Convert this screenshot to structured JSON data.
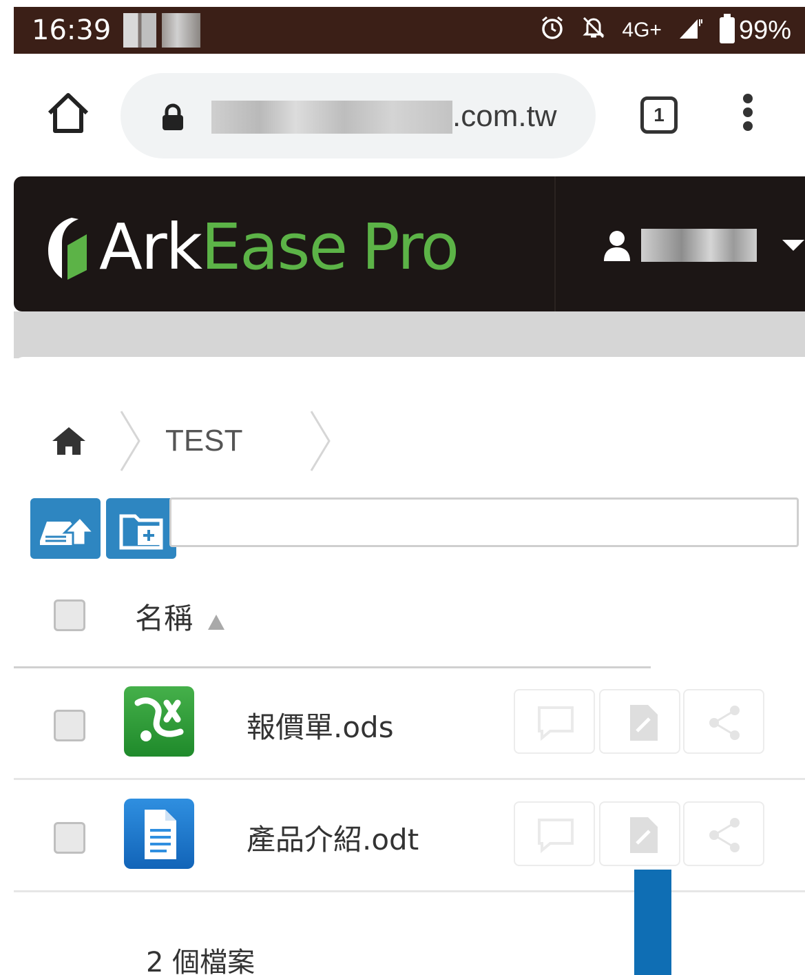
{
  "status_bar": {
    "time": "16:39",
    "network": "4G+",
    "battery": "99%"
  },
  "browser": {
    "url_suffix": ".com.tw",
    "tab_count": "1"
  },
  "app": {
    "logo_ark": "Ark",
    "logo_ease": "Ease",
    "logo_pro": "Pro",
    "brand_color": "#5cb347"
  },
  "breadcrumb": {
    "items": [
      "TEST"
    ]
  },
  "table": {
    "header_name": "名稱",
    "rows": [
      {
        "name": "報價單.ods",
        "type": "spreadsheet"
      },
      {
        "name": "產品介紹.odt",
        "type": "document"
      }
    ]
  },
  "footer": {
    "count_text": "2 個檔案"
  }
}
